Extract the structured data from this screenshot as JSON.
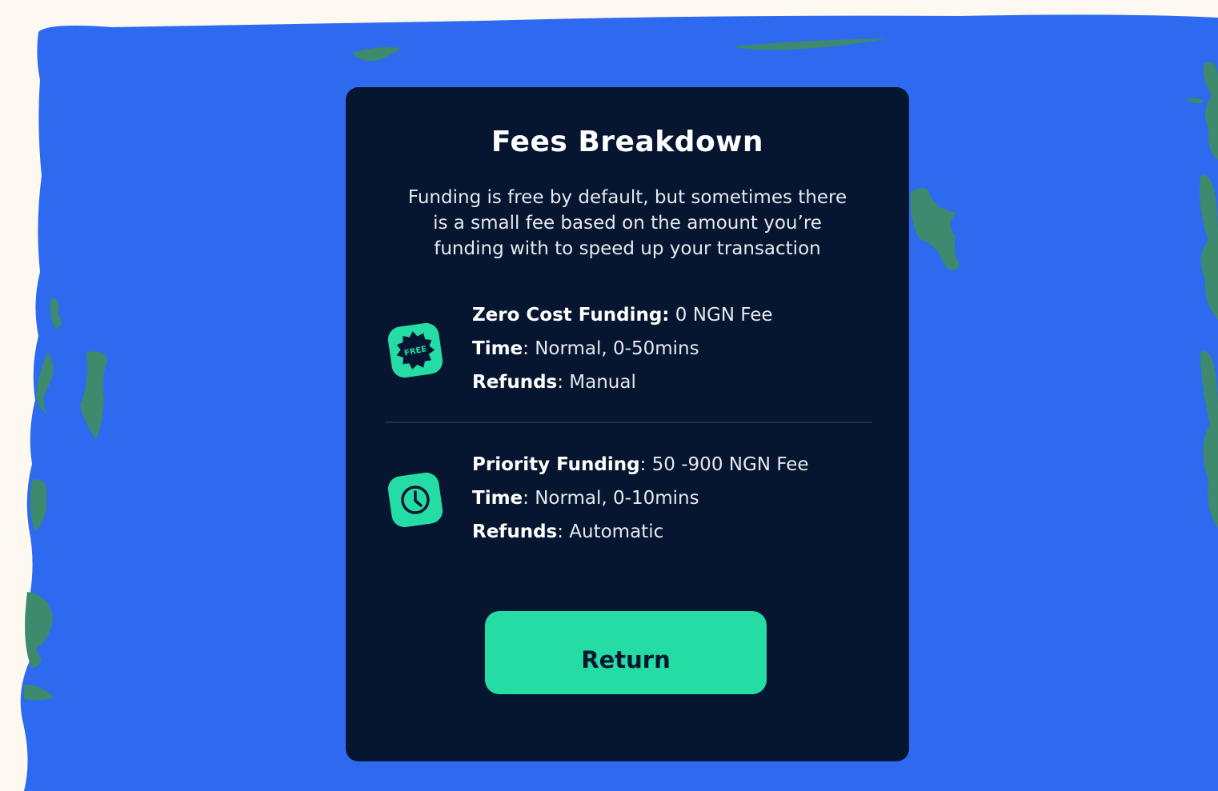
{
  "colors": {
    "page_background": "#fdf9f1",
    "blue_backdrop": "#2d6af0",
    "green_splash": "#3d8a6e",
    "card_background": "#061631",
    "accent_green": "#25dca4",
    "divider": "#17304d"
  },
  "modal": {
    "title": "Fees Breakdown",
    "description": "Funding is free by default, but sometimes there is a small fee based on the amount you’re funding with to speed up your transaction",
    "options": [
      {
        "icon": "free-badge-icon",
        "icon_text": "FREE",
        "name_label": "Zero Cost Funding:",
        "name_value": " 0 NGN Fee",
        "time_label": "Time",
        "time_value": ": Normal, 0-50mins",
        "refunds_label": "Refunds",
        "refunds_value": ": Manual"
      },
      {
        "icon": "clock-icon",
        "name_label": "Priority Funding",
        "name_value": ": 50 -900 NGN Fee",
        "time_label": "Time",
        "time_value": ": Normal, 0-10mins",
        "refunds_label": "Refunds",
        "refunds_value": ": Automatic"
      }
    ],
    "return_label": "Return"
  }
}
